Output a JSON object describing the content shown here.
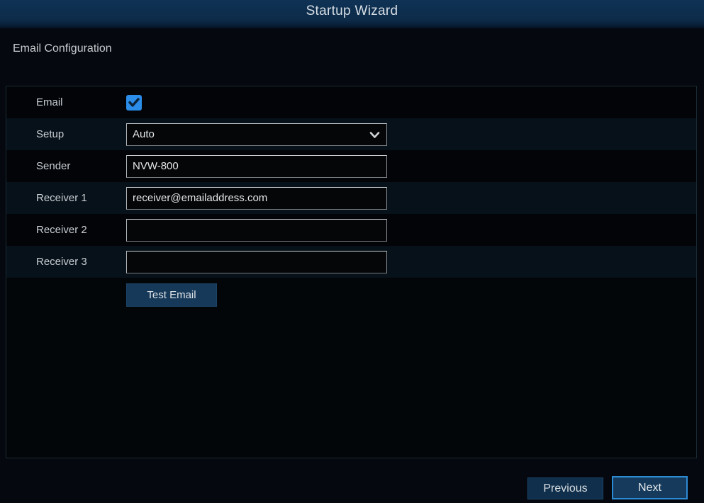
{
  "window": {
    "title": "Startup Wizard"
  },
  "page": {
    "heading": "Email Configuration"
  },
  "form": {
    "rows": [
      {
        "label": "Email",
        "type": "checkbox",
        "checked": true
      },
      {
        "label": "Setup",
        "type": "select",
        "value": "Auto"
      },
      {
        "label": "Sender",
        "type": "text",
        "value": "NVW-800"
      },
      {
        "label": "Receiver 1",
        "type": "text",
        "value": "receiver@emailaddress.com"
      },
      {
        "label": "Receiver 2",
        "type": "text",
        "value": ""
      },
      {
        "label": "Receiver 3",
        "type": "text",
        "value": ""
      }
    ],
    "test_button_label": "Test Email"
  },
  "footer": {
    "previous_label": "Previous",
    "next_label": "Next"
  },
  "icons": {
    "checkbox_check": "checkmark-icon",
    "select_arrow": "chevron-down-icon"
  },
  "colors": {
    "titlebar_blue": "#0d2b49",
    "accent_checkbox_blue": "#2b8de8",
    "next_border_blue": "#2d8bd3",
    "button_fill_blue": "#16395a",
    "row_light": "#071119",
    "row_dark": "#020408",
    "text_light": "#c9ced3"
  }
}
